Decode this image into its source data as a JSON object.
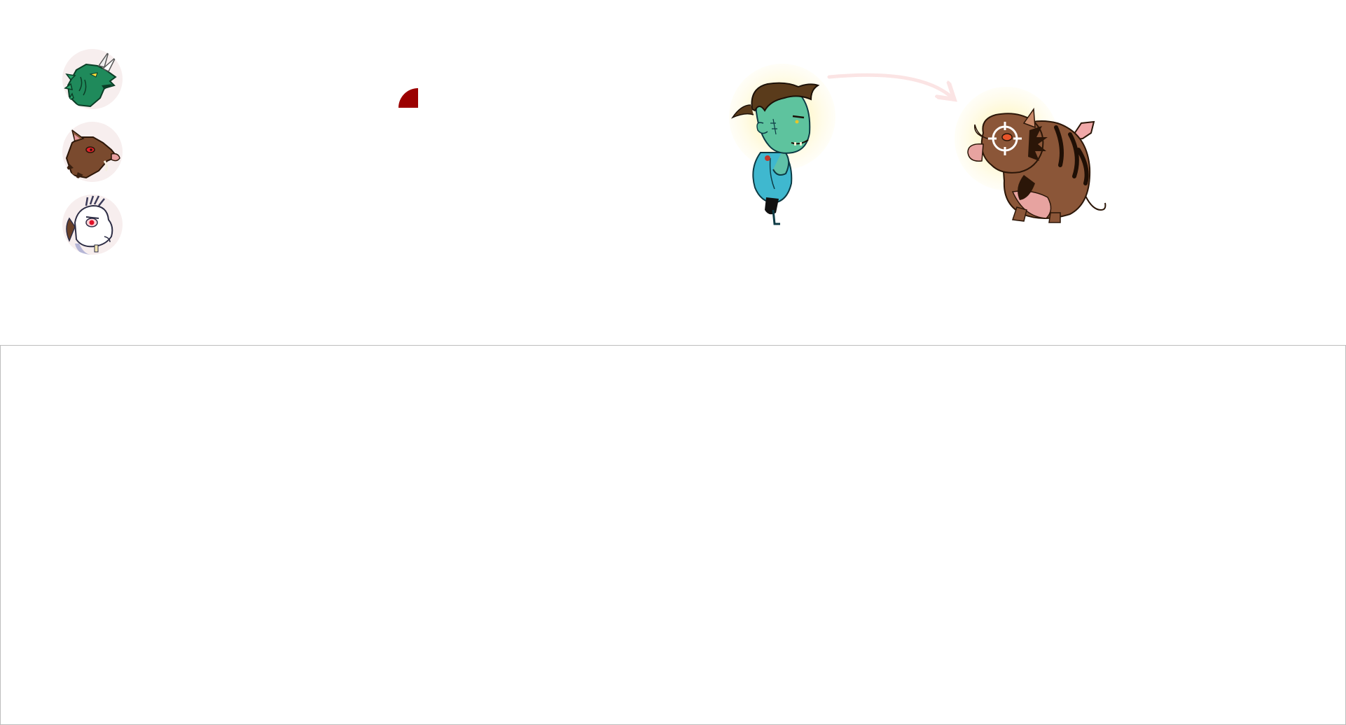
{
  "turn_order": {
    "portraits": [
      {
        "name": "green-dragon",
        "icon": "dragon-portrait-icon"
      },
      {
        "name": "wild-boar",
        "icon": "boar-portrait-icon"
      },
      {
        "name": "white-goat",
        "icon": "goat-portrait-icon"
      }
    ]
  },
  "turn_timer": {
    "icon": "timer-wedge-icon",
    "remaining_fraction": 0.25,
    "color": "#9b0000"
  },
  "battlefield": {
    "attacker": {
      "name": "zombie-hero",
      "highlight_color": "#fff3b0"
    },
    "target": {
      "name": "winged-boar",
      "highlight_color": "#fff3b0",
      "reticle_icon": "crosshair-icon"
    },
    "attack_arrow": {
      "color": "#fbe4e4"
    }
  },
  "colors": {
    "panel_border": "#bdbdbd",
    "portrait_bg": "#f7eeee"
  }
}
